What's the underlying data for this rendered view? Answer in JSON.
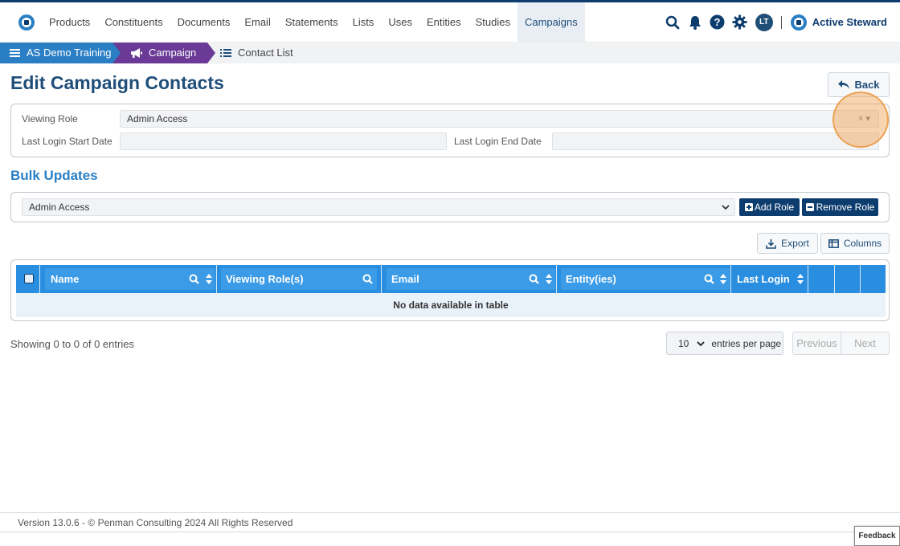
{
  "nav": {
    "items": [
      "Products",
      "Constituents",
      "Documents",
      "Email",
      "Statements",
      "Lists",
      "Uses",
      "Entities",
      "Studies",
      "Campaigns"
    ],
    "active": "Campaigns",
    "user_initials": "LT",
    "brand": "Active Steward"
  },
  "breadcrumb": {
    "items": [
      "AS Demo Training",
      "Campaign",
      "Contact List"
    ]
  },
  "page": {
    "title": "Edit Campaign Contacts",
    "back_label": "Back"
  },
  "filters": {
    "viewing_role_label": "Viewing Role",
    "viewing_role_value": "Admin Access",
    "clear_symbol": "× ▾",
    "start_date_label": "Last Login Start Date",
    "start_date_value": "",
    "end_date_label": "Last Login End Date",
    "end_date_value": ""
  },
  "bulk": {
    "title": "Bulk Updates",
    "role_value": "Admin Access",
    "add_role_label": "Add Role",
    "remove_role_label": "Remove Role"
  },
  "table_tools": {
    "export_label": "Export",
    "columns_label": "Columns"
  },
  "table": {
    "columns": [
      "Name",
      "Viewing Role(s)",
      "Email",
      "Entity(ies)",
      "Last Login"
    ],
    "empty_message": "No data available in table"
  },
  "pagination": {
    "summary": "Showing 0 to 0 of 0 entries",
    "per_page_value": "10",
    "per_page_label": "entries per page",
    "previous_label": "Previous",
    "next_label": "Next"
  },
  "footer": {
    "text": "Version 13.0.6 - © Penman Consulting 2024 All Rights Reserved",
    "feedback_label": "Feedback"
  },
  "colors": {
    "brand_navy": "#0d3c6e",
    "header_blue": "#2a8ee0",
    "crumb_blue": "#2a7fc4",
    "crumb_purple": "#6a3a96",
    "highlight_orange": "#f0a050"
  }
}
